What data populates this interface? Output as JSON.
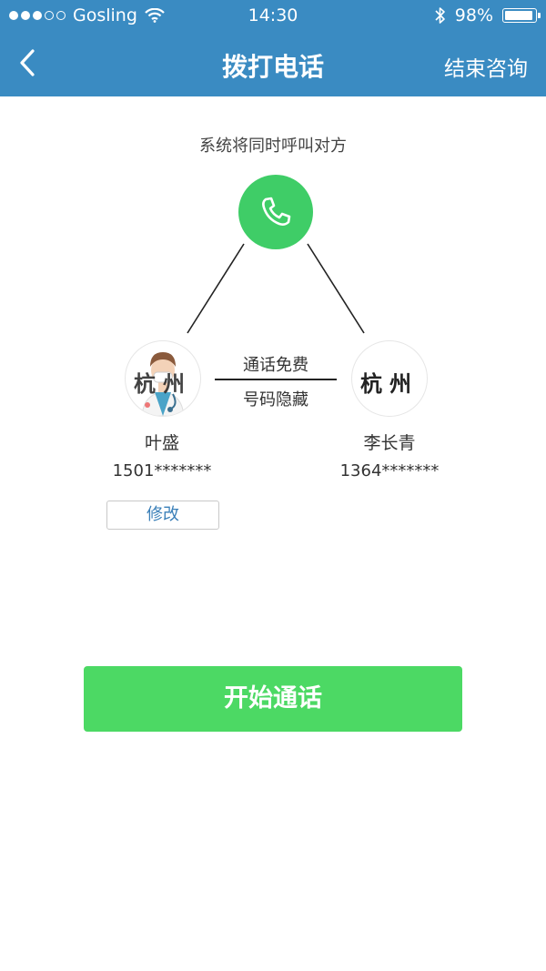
{
  "status_bar": {
    "carrier": "Gosling",
    "time": "14:30",
    "battery_text": "98%",
    "battery_level": 0.98
  },
  "nav": {
    "title": "拨打电话",
    "end_label": "结束咨询"
  },
  "call": {
    "caption": "系统将同时呼叫对方",
    "middle_top": "通话免费",
    "middle_bottom": "号码隐藏"
  },
  "left_party": {
    "avatar_text": "杭州",
    "name": "叶盛",
    "phone": "1501*******",
    "edit_label": "修改"
  },
  "right_party": {
    "avatar_text": "杭州",
    "name": "李长青",
    "phone": "1364*******"
  },
  "start_button": {
    "label": "开始通话"
  },
  "colors": {
    "header": "#3a8bc2",
    "accent_green": "#4cd964",
    "phone_circle": "#3fcd67",
    "link_blue": "#3a7fb8"
  }
}
